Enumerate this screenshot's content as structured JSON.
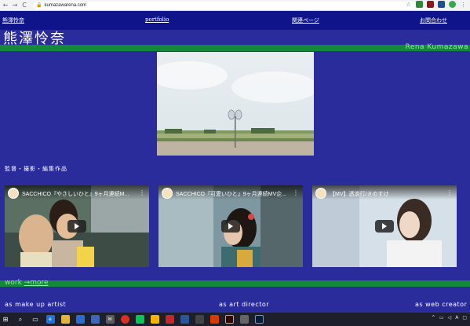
{
  "browser": {
    "url": "kumazawarena.com",
    "nav": [
      "←",
      "→",
      "C"
    ],
    "lock_icon": "🔒"
  },
  "nav": {
    "items": [
      "熊澤怜奈",
      "portfolio",
      "関連ページ",
      "お問合わせ"
    ]
  },
  "logo": "熊澤怜奈",
  "romanized_name": "Rena Kumazawa",
  "section": {
    "title": "監督・撮影・編集作品"
  },
  "videos": [
    {
      "title": "SACCHICO『やさしいひと』9ヶ月連続M..."
    },
    {
      "title": "SACCHICO『可愛いひと』9ヶ月連続MV企..."
    },
    {
      "title": "【MV】透過行/きのすけ"
    }
  ],
  "work_link": {
    "prefix": "work",
    "link": "→more"
  },
  "bottom_links": [
    "as make up artist",
    "as art director",
    "as web creator"
  ],
  "colors": {
    "page_bg": "#2a2c9c",
    "nav_bg": "#10148a",
    "green": "#138a3a",
    "accent_text": "#9fe1a6"
  }
}
